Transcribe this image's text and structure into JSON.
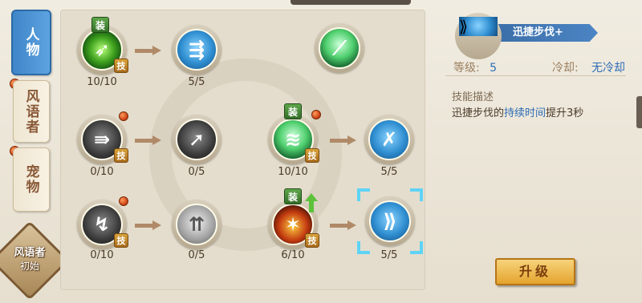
{
  "tabs": [
    {
      "label": "人物",
      "active": true
    },
    {
      "label": "风语者",
      "active": false
    },
    {
      "label": "宠物",
      "active": false
    }
  ],
  "class_badge": {
    "title": "风语者",
    "subtitle": "初始"
  },
  "skill_rows": [
    {
      "skills": [
        {
          "icon": "wind-burst-icon",
          "level": "10/10",
          "equip_tag": "装",
          "skill_tag": "技",
          "alert": true
        },
        {
          "icon": "arrow-volley-icon",
          "level": "5/5"
        },
        {
          "icon": "green-slash-icon",
          "level": ""
        }
      ]
    },
    {
      "skills": [
        {
          "icon": "multi-arrow-icon",
          "level": "0/10",
          "skill_tag": "技",
          "alert": true
        },
        {
          "icon": "piercing-arrow-icon",
          "level": "0/5"
        },
        {
          "icon": "green-wind-icon",
          "level": "10/10",
          "equip_tag": "装",
          "skill_tag": "技",
          "alert": true
        },
        {
          "icon": "crossed-arrows-icon",
          "level": "5/5"
        }
      ]
    },
    {
      "skills": [
        {
          "icon": "shadow-arrow-icon",
          "level": "0/10",
          "skill_tag": "技",
          "alert": true
        },
        {
          "icon": "trident-icon",
          "level": "0/5"
        },
        {
          "icon": "fire-shot-icon",
          "level": "6/10",
          "equip_tag": "装",
          "skill_tag": "技",
          "upgrade_available": true
        },
        {
          "icon": "swift-step-icon",
          "level": "5/5",
          "selected": true
        }
      ]
    }
  ],
  "detail": {
    "name": "迅捷步伐+",
    "icon": "swift-step-icon",
    "level_label": "等级:",
    "level_value": "5",
    "cooldown_label": "冷却:",
    "cooldown_value": "无冷却",
    "desc_title": "技能描述",
    "desc_prefix": "迅捷步伐的",
    "desc_highlight": "持续时间",
    "desc_suffix": "提升3秒",
    "upgrade_label": "升级"
  },
  "colors": {
    "accent_blue": "#2d6cb5",
    "tab_active": "#3f86c9",
    "upgrade_button": "#e4a42e",
    "select_frame": "#5fd3f5"
  }
}
